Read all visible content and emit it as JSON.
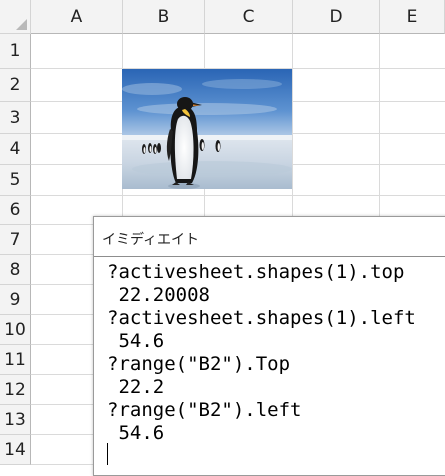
{
  "spreadsheet": {
    "columns": [
      "A",
      "B",
      "C",
      "D",
      "E"
    ],
    "rows": [
      "1",
      "2",
      "3",
      "4",
      "5",
      "6",
      "7",
      "8",
      "9",
      "10",
      "11",
      "12",
      "13",
      "14"
    ],
    "grid_color": "#dadada",
    "header_bg": "#f3f3f3"
  },
  "picture": {
    "subject": "penguin-photo"
  },
  "immediate_window": {
    "title": "イミディエイト",
    "lines": [
      "?activesheet.shapes(1).top",
      " 22.20008",
      "?activesheet.shapes(1).left",
      " 54.6",
      "?range(\"B2\").Top",
      " 22.2",
      "?range(\"B2\").left",
      " 54.6"
    ]
  }
}
